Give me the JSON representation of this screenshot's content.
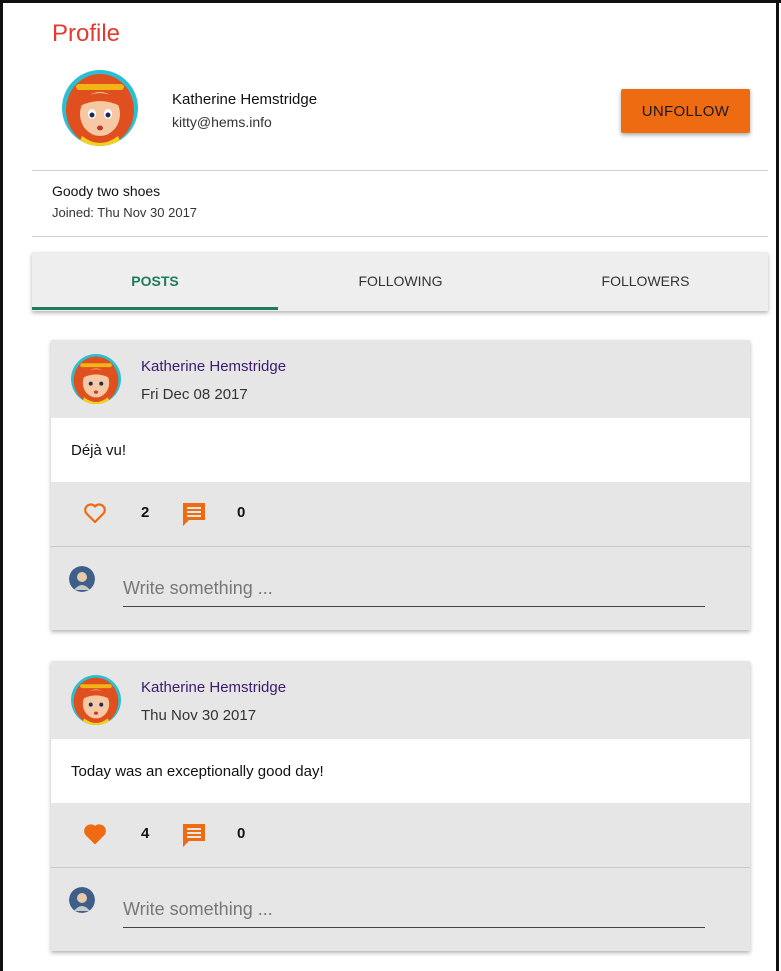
{
  "page": {
    "title": "Profile"
  },
  "profile": {
    "name": "Katherine Hemstridge",
    "email": "kitty@hems.info",
    "bio": "Goody two shoes",
    "joined": "Joined: Thu Nov 30 2017",
    "unfollow_label": "UNFOLLOW",
    "avatar_icon": "girl-avatar-icon"
  },
  "tabs": [
    {
      "label": "POSTS",
      "active": true
    },
    {
      "label": "FOLLOWING",
      "active": false
    },
    {
      "label": "FOLLOWERS",
      "active": false
    }
  ],
  "posts": [
    {
      "author": "Katherine Hemstridge",
      "date": "Fri Dec 08 2017",
      "text": "Déjà vu!",
      "likes": "2",
      "liked": false,
      "comments": "0",
      "comment_placeholder": "Write something ..."
    },
    {
      "author": "Katherine Hemstridge",
      "date": "Thu Nov 30 2017",
      "text": "Today was an exceptionally good day!",
      "likes": "4",
      "liked": true,
      "comments": "0",
      "comment_placeholder": "Write something ..."
    }
  ],
  "colors": {
    "title": "#e53b2f",
    "accent": "#ee6b11",
    "tab_active": "#1f7a5e",
    "author": "#3b1a6e"
  }
}
